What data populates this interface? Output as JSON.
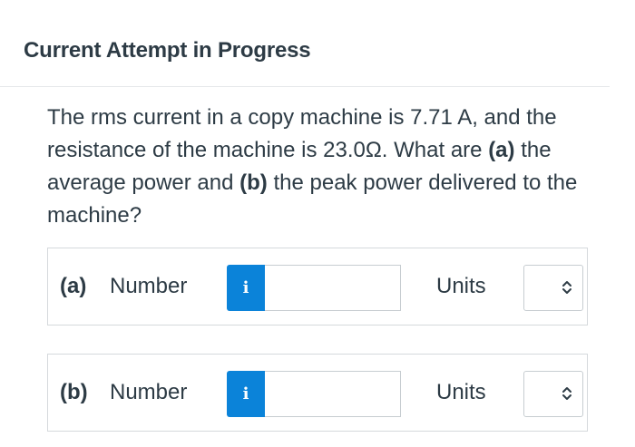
{
  "header": {
    "title": "Current Attempt in Progress"
  },
  "question": {
    "text_1": "The rms current in a copy machine is 7.71 A, and the resistance of the machine is 23.0Ω. What are ",
    "part_a_marker": "(a)",
    "text_2": " the average power and ",
    "part_b_marker": "(b)",
    "text_3": " the peak power delivered to the machine?"
  },
  "answers": [
    {
      "part_label": "(a)",
      "number_label": "Number",
      "info_icon": "info-icon",
      "info_glyph": "i",
      "number_value": "",
      "units_label": "Units",
      "units_selected": ""
    },
    {
      "part_label": "(b)",
      "number_label": "Number",
      "info_icon": "info-icon",
      "info_glyph": "i",
      "number_value": "",
      "units_label": "Units",
      "units_selected": ""
    }
  ],
  "colors": {
    "info_button": "#0b83d9",
    "text": "#2d3b45",
    "border": "#d5d9dc"
  }
}
